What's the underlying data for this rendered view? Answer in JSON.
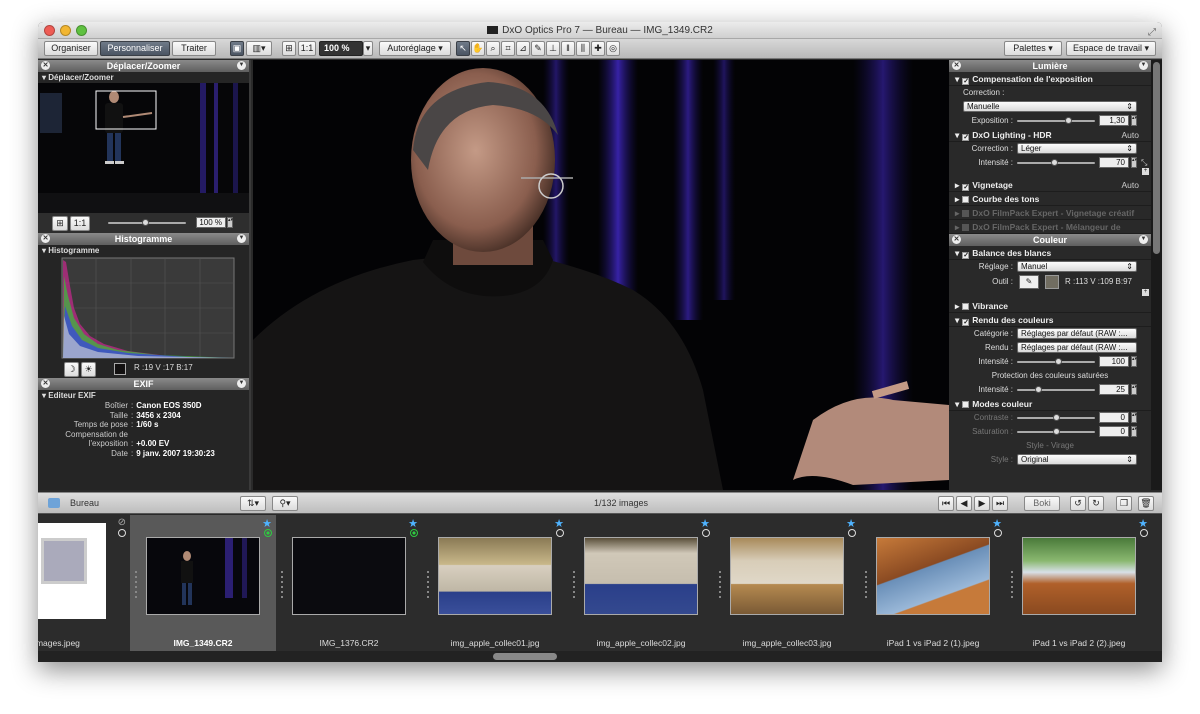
{
  "window": {
    "title": "DxO Optics Pro 7 — Bureau — IMG_1349.CR2"
  },
  "toolbar": {
    "modes": [
      "Organiser",
      "Personnaliser",
      "Traiter"
    ],
    "fit_label": "1:1",
    "zoom_value": "100 %",
    "autoreglage": "Autoréglage",
    "palettes": "Palettes",
    "workspace": "Espace de travail"
  },
  "left": {
    "zoom_panel": {
      "title": "Déplacer/Zoomer",
      "subtitle": "Déplacer/Zoomer",
      "fit": "1:1",
      "zoom_value": "100 %"
    },
    "histogram_panel": {
      "title": "Histogramme",
      "subtitle": "Histogramme",
      "rgb": "R :19 V :17 B:17"
    },
    "exif_panel": {
      "title": "EXIF",
      "subtitle": "Editeur EXIF",
      "rows": [
        {
          "label": "Boîtier",
          "value": "Canon EOS 350D"
        },
        {
          "label": "Taille",
          "value": "3456 x 2304"
        },
        {
          "label": "Temps de pose",
          "value": "1/60 s"
        },
        {
          "label": "Compensation de",
          "value": ""
        },
        {
          "label": "l'exposition",
          "value": "+0.00 EV"
        },
        {
          "label": "Date",
          "value": "9 janv. 2007 19:30:23"
        }
      ]
    }
  },
  "right": {
    "lumiere": {
      "title": "Lumière",
      "exposure": {
        "title": "Compensation de l'exposition",
        "correction_label": "Correction :",
        "correction_value": "Manuelle",
        "exposition_label": "Exposition :",
        "exposition_value": "1,30"
      },
      "lighting": {
        "title": "DxO Lighting - HDR",
        "auto": "Auto",
        "correction_label": "Correction :",
        "correction_value": "Léger",
        "intensite_label": "Intensité :",
        "intensite_value": "70"
      },
      "vignetage": {
        "title": "Vignetage",
        "auto": "Auto"
      },
      "courbe": {
        "title": "Courbe des tons"
      },
      "filmpack1": {
        "title": "DxO FilmPack Expert - Vignetage créatif"
      },
      "filmpack2": {
        "title": "DxO FilmPack Expert - Mélangeur de canaux"
      }
    },
    "couleur": {
      "title": "Couleur",
      "balance": {
        "title": "Balance des blancs",
        "reglage_label": "Réglage :",
        "reglage_value": "Manuel",
        "outil_label": "Outil :",
        "rgb": "R :113 V :109 B:97"
      },
      "vibrance": {
        "title": "Vibrance"
      },
      "rendu": {
        "title": "Rendu des couleurs",
        "categorie_label": "Catégorie :",
        "categorie_value": "Réglages par défaut (RAW :...",
        "rendu_label": "Rendu :",
        "rendu_value": "Réglages par défaut (RAW :...",
        "intensite_label": "Intensité :",
        "intensite_value": "100",
        "protection_label": "Protection des couleurs saturées",
        "intensite2_label": "Intensité :",
        "intensite2_value": "25"
      },
      "modes": {
        "title": "Modes couleur",
        "contraste_label": "Contraste :",
        "contraste_value": "0",
        "saturation_label": "Saturation :",
        "saturation_value": "0",
        "style_label": "Style - Virage",
        "style_field_label": "Style :",
        "style_value": "Original"
      }
    }
  },
  "filmstrip": {
    "folder": "Bureau",
    "count": "1/132 images",
    "btn_label": "Boki",
    "items": [
      {
        "name": "images.jpeg"
      },
      {
        "name": "IMG_1349.CR2"
      },
      {
        "name": "IMG_1376.CR2"
      },
      {
        "name": "img_apple_collec01.jpg"
      },
      {
        "name": "img_apple_collec02.jpg"
      },
      {
        "name": "img_apple_collec03.jpg"
      },
      {
        "name": "iPad 1 vs iPad 2 (1).jpeg"
      },
      {
        "name": "iPad 1 vs iPad 2 (2).jpeg"
      }
    ]
  },
  "colors": {
    "accent_star": "#4fb3ff",
    "status_green": "#2ecc40",
    "panel_header": "#6f6f6f"
  }
}
